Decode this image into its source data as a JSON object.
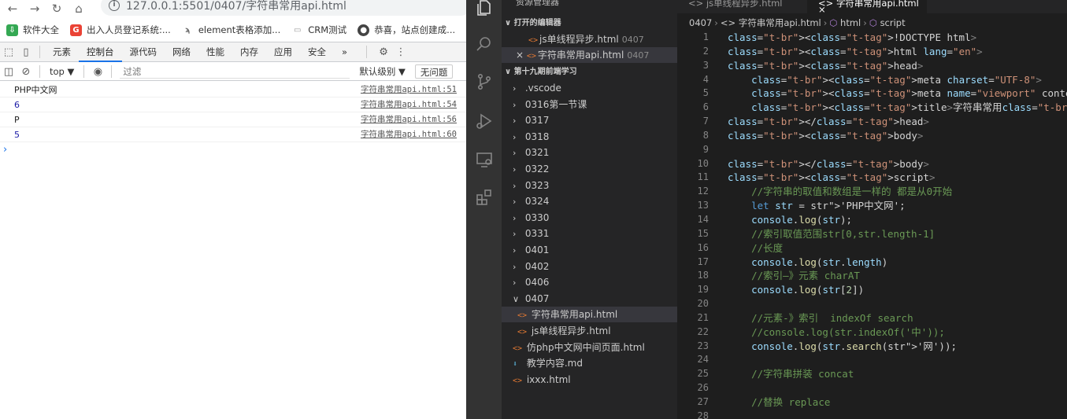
{
  "browser": {
    "url": "127.0.0.1:5501/0407/字符串常用api.html",
    "bookmarks": [
      {
        "label": "软件大全",
        "icon": "download-icon",
        "color": "#34a853"
      },
      {
        "label": "出入人员登记系统:...",
        "icon": "g-icon",
        "color": "#ea4335"
      },
      {
        "label": "element表格添加...",
        "icon": "element-icon",
        "color": "#666666"
      },
      {
        "label": "CRM测试",
        "icon": "page-icon",
        "color": "#999999"
      },
      {
        "label": "恭喜，站点创建成...",
        "icon": "globe-icon",
        "color": "#444444"
      }
    ],
    "devtools_tabs": [
      "元素",
      "控制台",
      "源代码",
      "网络",
      "性能",
      "内存",
      "应用",
      "安全"
    ],
    "active_tab": "控制台",
    "more_tabs": "»",
    "context": "top ▼",
    "filter_placeholder": "过滤",
    "level": "默认级别 ▼",
    "issues": "无问题",
    "logs": [
      {
        "message": "PHP中文网",
        "source": "字符串常用api.html:51",
        "numeric": false
      },
      {
        "message": "6",
        "source": "字符串常用api.html:54",
        "numeric": true
      },
      {
        "message": "P",
        "source": "字符串常用api.html:56",
        "numeric": false
      },
      {
        "message": "5",
        "source": "字符串常用api.html:60",
        "numeric": true
      }
    ],
    "prompt": "›"
  },
  "vscode": {
    "explorer_title": "资源管理器",
    "open_editors_label": "打开的编辑器",
    "open_editors": [
      {
        "name": "js单线程异步.html",
        "dir": "0407",
        "close": ""
      },
      {
        "name": "字符串常用api.html",
        "dir": "0407",
        "close": "×"
      }
    ],
    "workspace_label": "第十九期前端学习",
    "tree": [
      {
        "name": ".vscode",
        "type": "folder",
        "open": false
      },
      {
        "name": "0316第一节课",
        "type": "folder",
        "open": false
      },
      {
        "name": "0317",
        "type": "folder",
        "open": false
      },
      {
        "name": "0318",
        "type": "folder",
        "open": false
      },
      {
        "name": "0321",
        "type": "folder",
        "open": false
      },
      {
        "name": "0322",
        "type": "folder",
        "open": false
      },
      {
        "name": "0323",
        "type": "folder",
        "open": false
      },
      {
        "name": "0324",
        "type": "folder",
        "open": false
      },
      {
        "name": "0330",
        "type": "folder",
        "open": false
      },
      {
        "name": "0331",
        "type": "folder",
        "open": false
      },
      {
        "name": "0401",
        "type": "folder",
        "open": false
      },
      {
        "name": "0402",
        "type": "folder",
        "open": false
      },
      {
        "name": "0406",
        "type": "folder",
        "open": false
      },
      {
        "name": "0407",
        "type": "folder",
        "open": true
      },
      {
        "name": "字符串常用api.html",
        "type": "html",
        "nested": true,
        "selected": true
      },
      {
        "name": "js单线程异步.html",
        "type": "html",
        "nested": true
      },
      {
        "name": "仿php中文网中间页面.html",
        "type": "html"
      },
      {
        "name": "教学内容.md",
        "type": "md"
      },
      {
        "name": "ixxx.html",
        "type": "html"
      }
    ],
    "tabs": [
      {
        "label": "js单线程异步.html",
        "active": false
      },
      {
        "label": "字符串常用api.html ×",
        "active": true
      }
    ],
    "breadcrumb": [
      "0407",
      "字符串常用api.html",
      "html",
      "script"
    ],
    "code_lines": [
      {
        "n": "1",
        "t": "<!DOCTYPE html>"
      },
      {
        "n": "2",
        "t": "<html lang=\"en\">"
      },
      {
        "n": "3",
        "t": "<head>"
      },
      {
        "n": "4",
        "t": "    <meta charset=\"UTF-8\">"
      },
      {
        "n": "5",
        "t": "    <meta name=\"viewport\" content=\"width=device-width, initi"
      },
      {
        "n": "6",
        "t": "    <title>字符串常用</title>"
      },
      {
        "n": "7",
        "t": "</head>"
      },
      {
        "n": "8",
        "t": "<body>"
      },
      {
        "n": "9",
        "t": ""
      },
      {
        "n": "10",
        "t": "</body>"
      },
      {
        "n": "11",
        "t": "<script>"
      },
      {
        "n": "12",
        "t": "    //字符串的取值和数组是一样的 都是从0开始"
      },
      {
        "n": "13",
        "t": "    let str = 'PHP中文网';"
      },
      {
        "n": "14",
        "t": "    console.log(str);"
      },
      {
        "n": "15",
        "t": "    //索引取值范围str[0,str.length-1]"
      },
      {
        "n": "16",
        "t": "    //长度"
      },
      {
        "n": "17",
        "t": "    console.log(str.length)"
      },
      {
        "n": "18",
        "t": "    //索引—》元素 charAT"
      },
      {
        "n": "19",
        "t": "    console.log(str[2])"
      },
      {
        "n": "20",
        "t": ""
      },
      {
        "n": "21",
        "t": "    //元素-》索引  indexOf search"
      },
      {
        "n": "22",
        "t": "    //console.log(str.indexOf('中'));"
      },
      {
        "n": "23",
        "t": "    console.log(str.search('网'));"
      },
      {
        "n": "24",
        "t": ""
      },
      {
        "n": "25",
        "t": "    //字符串拼装 concat"
      },
      {
        "n": "26",
        "t": ""
      },
      {
        "n": "27",
        "t": "    //替换 replace"
      },
      {
        "n": "28",
        "t": ""
      }
    ]
  }
}
